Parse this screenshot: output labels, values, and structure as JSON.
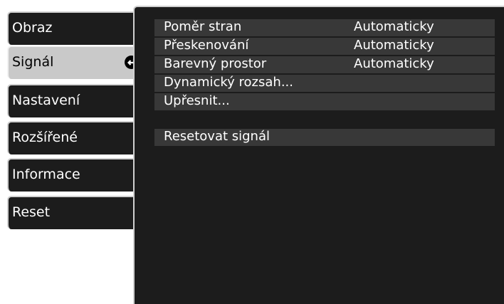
{
  "menu": {
    "items": [
      {
        "label": "Obraz"
      },
      {
        "label": "Signál"
      },
      {
        "label": "Nastavení"
      },
      {
        "label": "Rozšířené"
      },
      {
        "label": "Informace"
      },
      {
        "label": "Reset"
      }
    ],
    "active_index": 1,
    "enter_icon": "enter-arrow-icon"
  },
  "signal_settings": {
    "rows": [
      {
        "label": "Poměr stran",
        "value": "Automaticky"
      },
      {
        "label": "Přeskenování",
        "value": "Automaticky"
      },
      {
        "label": "Barevný prostor",
        "value": "Automaticky"
      },
      {
        "label": "Dynamický rozsah..."
      },
      {
        "label": "Upřesnit..."
      }
    ],
    "reset_label": "Resetovat signál"
  },
  "colors": {
    "panel_bg": "#1c1c1c",
    "row_bg": "#383838",
    "active_tab_bg": "#c9c9c9"
  }
}
